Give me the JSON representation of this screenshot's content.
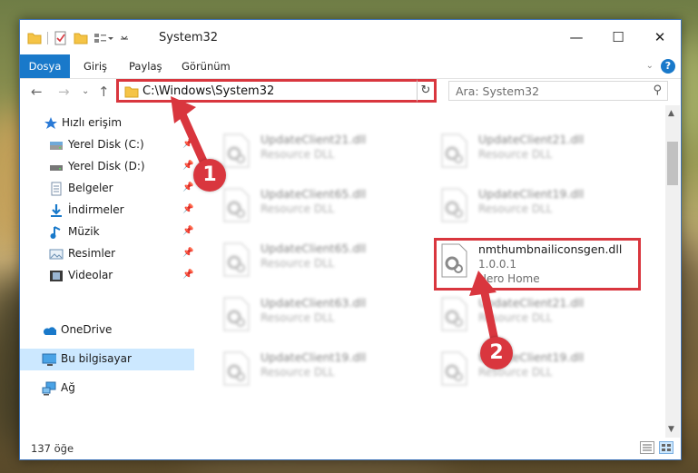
{
  "window": {
    "title": "System32"
  },
  "ribbon": {
    "tabs": [
      "Dosya",
      "Giriş",
      "Paylaş",
      "Görünüm"
    ],
    "help": "?"
  },
  "address": {
    "path": "C:\\Windows\\System32"
  },
  "search": {
    "placeholder": "Ara: System32"
  },
  "sidebar": {
    "items": [
      {
        "label": "Hızlı erişim",
        "icon": "star-icon"
      },
      {
        "label": "Yerel Disk (C:)",
        "icon": "drive-icon",
        "pinned": true
      },
      {
        "label": "Yerel Disk (D:)",
        "icon": "drive-icon",
        "pinned": true
      },
      {
        "label": "Belgeler",
        "icon": "documents-icon",
        "pinned": true
      },
      {
        "label": "İndirmeler",
        "icon": "download-icon",
        "pinned": true
      },
      {
        "label": "Müzik",
        "icon": "music-icon",
        "pinned": true
      },
      {
        "label": "Resimler",
        "icon": "pictures-icon",
        "pinned": true
      },
      {
        "label": "Videolar",
        "icon": "videos-icon",
        "pinned": true
      },
      {
        "label": "OneDrive",
        "icon": "cloud-icon"
      },
      {
        "label": "Bu bilgisayar",
        "icon": "computer-icon",
        "selected": true
      },
      {
        "label": "Ağ",
        "icon": "network-icon"
      }
    ]
  },
  "files": [
    {
      "name": "UpdateClient21.dll",
      "type": "Resource DLL"
    },
    {
      "name": "UpdateClient21.dll",
      "type": "Resource DLL"
    },
    {
      "name": "UpdateClient65.dll",
      "type": "Resource DLL"
    },
    {
      "name": "UpdateClient19.dll",
      "type": "Resource DLL"
    },
    {
      "name": "UpdateClient65.dll",
      "type": "Resource DLL"
    },
    {
      "name": "nmthumbnailiconsgen.dll",
      "version": "1.0.0.1",
      "company": "Nero Home",
      "highlighted": true
    },
    {
      "name": "UpdateClient63.dll",
      "type": "Resource DLL"
    },
    {
      "name": "UpdateClient21.dll",
      "type": "Resource DLL"
    },
    {
      "name": "UpdateClient19.dll",
      "type": "Resource DLL"
    },
    {
      "name": "UpdateClient19.dll",
      "type": "Resource DLL"
    }
  ],
  "status": {
    "item_count": "137 öğe"
  },
  "markers": [
    "1",
    "2"
  ],
  "colors": {
    "accent": "#1979ca",
    "highlight": "#d9363e",
    "selected": "#cce8ff"
  }
}
